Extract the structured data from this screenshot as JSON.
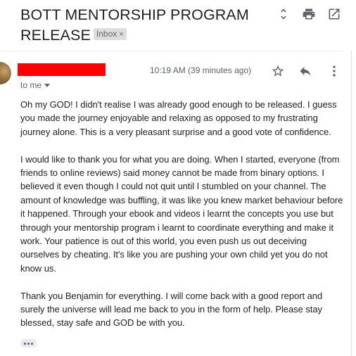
{
  "email": {
    "subject": "BOTT MENTORSHIP PROGRAM RELEASE",
    "label": "Inbox",
    "label_close": "×",
    "time": "10:19 AM (39 minutes ago)",
    "to": "to me",
    "paragraphs": [
      "Oh my GOD! I didn't realise I was already good enough to be released. I guess you made the journey enjoyable and relaxing as opposed to my frustrating journey alone. This is a very pleasant surprise and a good vote of confidence.",
      "I would like to thank you for what you are doing. When I started, everyone (from friends to online reviews) said money cannot be made from binary options. I believed it even though I could not quit until I stumbled on your channel. The amount of knowledge was buffling, it was like you knew market behaviour before it happened. Through your ebook and videos i learnt the concepts you use but through your mentorship program i learnt to coordinate everything and make it work. Your patience is out of this world, you even push us out deceiving ourselves by cheating. It's like you are pushing your own child yet you do not know us.",
      "Thank you Benjamin for everything. I will come back with a good report and surely the universe will lead me back to you in the form of help. Please stay blessed, stay safe and GOD be with you."
    ]
  },
  "icons": {
    "top": [
      "expand-collapse-icon",
      "print-icon",
      "open-in-new-window-icon"
    ],
    "actions": [
      "star-icon",
      "reply-icon",
      "more-vert-icon"
    ],
    "show_trimmed": "more-horiz-icon"
  },
  "colors": {
    "redaction": "#ff0000",
    "icon": "#5f6368",
    "text": "#222222",
    "badge_bg": "#dddddd"
  }
}
